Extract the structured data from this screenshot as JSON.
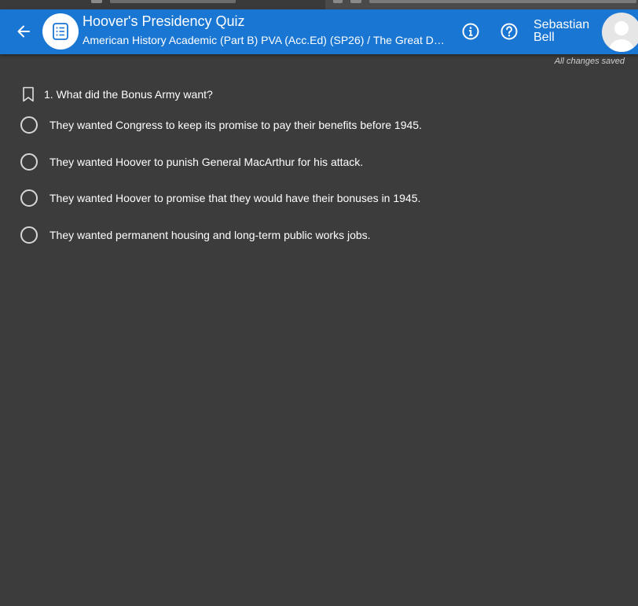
{
  "header": {
    "title": "Hoover's Presidency Quiz",
    "subtitle": "American History Academic (Part B) PVA (Acc.Ed) (SP26) / The Great De...",
    "user_first": "Sebastian",
    "user_last": "Bell",
    "icons": {
      "back": "arrow-left-icon",
      "quiz": "quiz-list-icon",
      "info": "info-icon",
      "help": "help-icon"
    }
  },
  "status": {
    "saved_text": "All changes saved"
  },
  "question": {
    "number": "1.",
    "text": "What did the Bonus Army want?",
    "options": [
      "They wanted Congress to keep its promise to pay their benefits before 1945.",
      "They wanted Hoover to punish General MacArthur for his attack.",
      "They wanted Hoover to promise that they would have their bonuses in 1945.",
      "They wanted permanent housing and long-term public works jobs."
    ],
    "selected": null
  },
  "colors": {
    "header_bg": "#1976d2",
    "page_bg": "#3c3c3c",
    "text": "#ffffff"
  }
}
